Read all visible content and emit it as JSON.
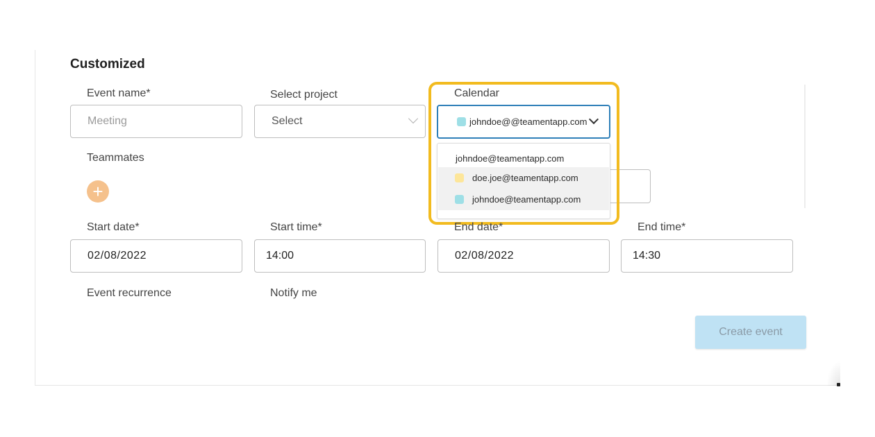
{
  "section_title": "Customized",
  "event_name": {
    "label": "Event name*",
    "placeholder": "Meeting"
  },
  "project": {
    "label": "Select project",
    "value": "Select"
  },
  "calendar": {
    "label": "Calendar",
    "selected": {
      "text": "johndoe@@teamentapp.com",
      "color": "#9edfe6"
    },
    "dropdown": {
      "header": "johndoe@teamentapp.com",
      "items": [
        {
          "text": "doe.joe@teamentapp.com",
          "color": "#fde69a"
        },
        {
          "text": "johndoe@teamentapp.com",
          "color": "#9edfe6"
        }
      ]
    }
  },
  "teammates": {
    "label": "Teammates",
    "add_icon": "plus-icon"
  },
  "start_date": {
    "label": "Start date*",
    "value": "02/08/2022"
  },
  "start_time": {
    "label": "Start time*",
    "value": "14:00"
  },
  "end_date": {
    "label": "End date*",
    "value": "02/08/2022"
  },
  "end_time": {
    "label": "End time*",
    "value": "14:30"
  },
  "recurrence": {
    "label": "Event recurrence"
  },
  "notify": {
    "label": "Notify me"
  },
  "create_button": {
    "label": "Create event"
  },
  "colors": {
    "highlight": "#f2bb1f",
    "focus_border": "#2e7fb8",
    "primary_disabled": "#bfe2f4",
    "add_button": "#f5c18c"
  }
}
